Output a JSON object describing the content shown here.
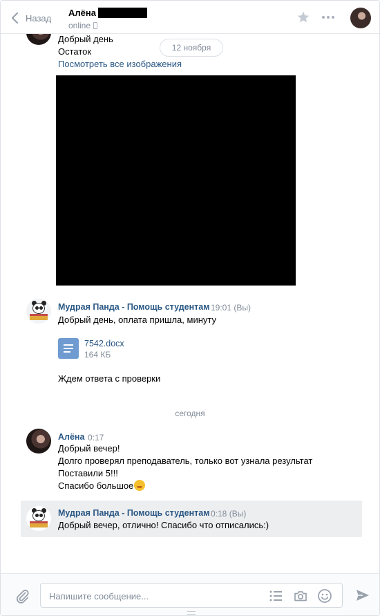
{
  "header": {
    "back_label": "Назад",
    "peer_name": "Алёна",
    "peer_status": "online"
  },
  "messages_area": {
    "first_block": {
      "lines": [
        "Добрый день",
        "Остаток"
      ],
      "view_all_link": "Посмотреть все изображения"
    },
    "date_pill": "12 ноября",
    "panda_block": {
      "author": "Мудрая Панда - Помощь студентам",
      "time": "19:01",
      "you_mark": "(Вы)",
      "text": "Добрый день, оплата пришла, минуту",
      "doc": {
        "name": "7542.docx",
        "size": "164 КБ"
      },
      "text2": "Ждем ответа с проверки"
    },
    "date_today": "сегодня",
    "alena_block": {
      "author": "Алёна",
      "time": "0:17",
      "lines": [
        "Добрый вечер!",
        "Долго проверял преподаватель, только вот узнала результат",
        "Поставили 5!!!",
        "Спасибо большое"
      ]
    },
    "panda_reply": {
      "author": "Мудрая Панда - Помощь студентам",
      "time": "0:18",
      "you_mark": "(Вы)",
      "text": "Добрый вечер, отлично! Спасибо что отписались:)"
    }
  },
  "composer": {
    "placeholder": "Напишите сообщение..."
  },
  "icons": {
    "back": "chevron-left-icon",
    "star": "star-icon",
    "more": "more-dots-icon",
    "attach": "paperclip-icon",
    "list": "list-icon",
    "camera": "camera-icon",
    "emoji": "smile-icon",
    "send": "send-icon"
  },
  "colors": {
    "link": "#2a5885",
    "muted": "#818c99",
    "highlight": "#edeef0",
    "doc_icon": "#6f9bd1"
  }
}
